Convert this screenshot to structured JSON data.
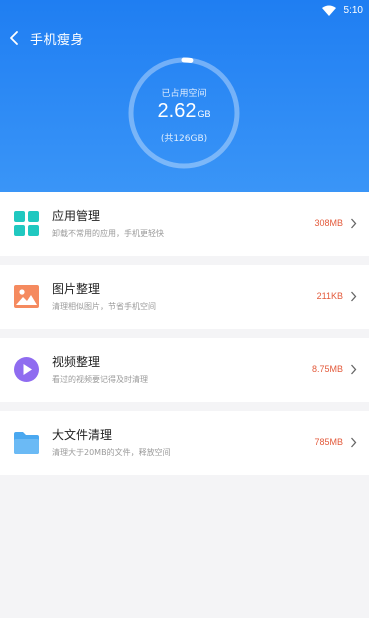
{
  "status": {
    "time": "5:10"
  },
  "header": {
    "title": "手机瘦身"
  },
  "storage": {
    "label": "已占用空间",
    "value": "2.62",
    "unit": "GB",
    "total": "(共126GB)",
    "used_fraction": 0.021
  },
  "items": [
    {
      "name": "应用管理",
      "desc": "卸载不常用的应用，手机更轻快",
      "size": "308MB",
      "icon": "apps-grid-icon",
      "color": "#20c8c0"
    },
    {
      "name": "图片整理",
      "desc": "清理相似图片，节省手机空间",
      "size": "211KB",
      "icon": "image-icon",
      "color": "#f58a5f"
    },
    {
      "name": "视频整理",
      "desc": "看过的视频要记得及时清理",
      "size": "8.75MB",
      "icon": "play-icon",
      "color": "#8f6cf0"
    },
    {
      "name": "大文件清理",
      "desc": "清理大于20MB的文件，释放空间",
      "size": "785MB",
      "icon": "folder-icon",
      "color": "#4aa8f0"
    }
  ],
  "colors": {
    "accent": "#2b88f4",
    "size_text": "#e35a3b"
  }
}
